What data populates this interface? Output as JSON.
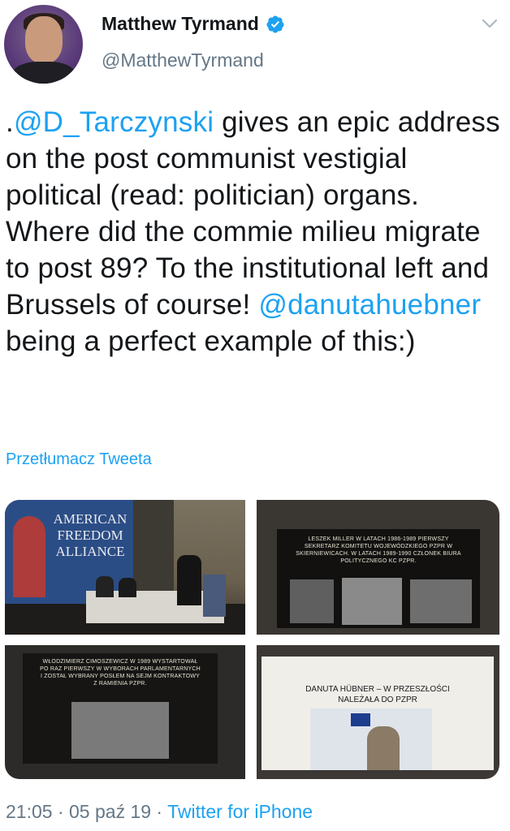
{
  "author": {
    "name": "Matthew Tyrmand",
    "handle": "@MatthewTyrmand",
    "verified": true
  },
  "icons": {
    "verified": "verified-badge-icon",
    "menu": "chevron-down-icon"
  },
  "tweet": {
    "segments": [
      {
        "text": ".",
        "type": "text"
      },
      {
        "text": "@D_Tarczynski",
        "type": "mention"
      },
      {
        "text": " gives an epic address on the post communist vestigial political (read: politician) organs. Where did the commie milieu migrate to post 89? To the institutional left and Brussels of course! ",
        "type": "text"
      },
      {
        "text": "@danutahuebner",
        "type": "mention"
      },
      {
        "text": " being a perfect example of this:)",
        "type": "text"
      }
    ],
    "translate_label": "Przetłumacz Tweeta"
  },
  "media": {
    "photo1": {
      "banner": "AMERICAN FREEDOM ALLIANCE"
    },
    "photo2": {
      "slide": "LESZEK MILLER W LATACH 1986-1989 PIERWSZY SEKRETARZ KOMITETU WOJEWÓDZKIEGO PZPR W SKIERNIEWICACH. W LATACH 1989-1990 CZŁONEK BIURA POLITYCZNEGO KC PZPR."
    },
    "photo3": {
      "slide": "WŁODZIMIERZ CIMOSZEWICZ W 1989 WYSTARTOWAŁ PO RAZ PIERWSZY W WYBORACH PARLAMENTARNYCH I ZOSTAŁ WYBRANY POSŁEM NA SEJM KONTRAKTOWY Z RAMIENIA PZPR."
    },
    "photo4": {
      "slide": "DANUTA HÜBNER – W PRZESZŁOŚCI NALEŻAŁA DO PZPR"
    }
  },
  "meta": {
    "time": "21:05",
    "sep1": " · ",
    "date": "05 paź 19",
    "sep2": " · ",
    "source": "Twitter for iPhone"
  },
  "colors": {
    "accent": "#1da1f2",
    "text": "#14171a",
    "secondary": "#657786"
  }
}
